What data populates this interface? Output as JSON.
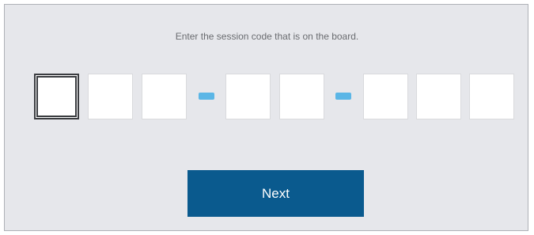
{
  "prompt": "Enter the session code that is on the board.",
  "code_inputs": [
    {
      "value": "",
      "active": true
    },
    {
      "value": "",
      "active": false
    },
    {
      "value": "",
      "active": false
    },
    {
      "value": "",
      "active": false
    },
    {
      "value": "",
      "active": false
    },
    {
      "value": "",
      "active": false
    },
    {
      "value": "",
      "active": false
    },
    {
      "value": "",
      "active": false
    }
  ],
  "next_button": {
    "label": "Next"
  },
  "colors": {
    "accent": "#0a5a8e",
    "separator": "#5bb6e6",
    "panel_bg": "#e6e7eb"
  }
}
